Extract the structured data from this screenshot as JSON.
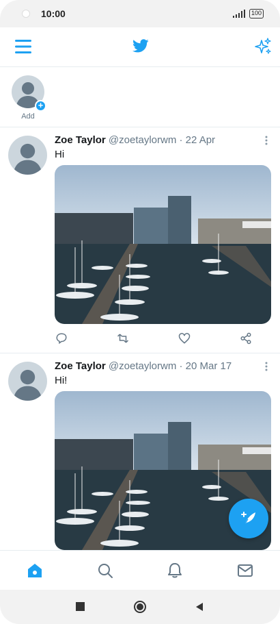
{
  "status": {
    "time": "10:00",
    "battery": "100"
  },
  "topbar": {
    "menu_icon": "menu-icon",
    "logo_icon": "twitter-bird-icon",
    "sparkle_icon": "sparkle-icon"
  },
  "fleets": {
    "add_label": "Add"
  },
  "tweets": [
    {
      "name": "Zoe Taylor",
      "handle": "@zoetaylorwm",
      "date": "· 22 Apr",
      "text": "Hi"
    },
    {
      "name": "Zoe Taylor",
      "handle": "@zoetaylorwm",
      "date": "· 20 Mar 17",
      "text": "Hi!"
    }
  ],
  "colors": {
    "accent": "#1da1f2",
    "secondary_text": "#657786",
    "divider": "#e6ecf0"
  },
  "bottom_nav": [
    "home-icon",
    "search-icon",
    "notifications-icon",
    "messages-icon"
  ],
  "system_nav": [
    "recents-icon",
    "home-circle-icon",
    "back-icon"
  ]
}
